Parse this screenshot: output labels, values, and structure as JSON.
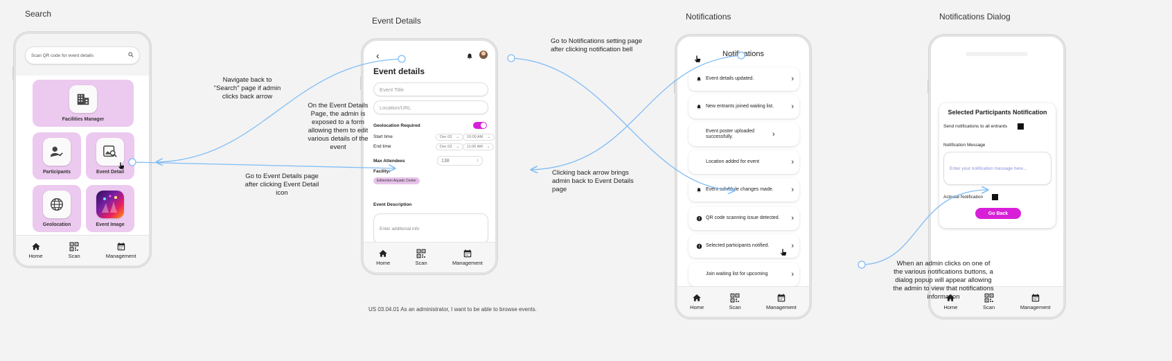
{
  "screens": {
    "search": {
      "label": "Search"
    },
    "event_details": {
      "label": "Event Details"
    },
    "notifications": {
      "label": "Notifications"
    },
    "notifications_dialog": {
      "label": "Notifications Dialog"
    }
  },
  "search_screen": {
    "search_placeholder": "Scan QR code for event details",
    "tiles": {
      "facilities": "Facilities Manager",
      "participants": "Participants",
      "event_detail": "Event Detail",
      "geolocation": "Geolocation",
      "event_image": "Event Image"
    }
  },
  "navbar": {
    "home": "Home",
    "scan": "Scan",
    "management": "Management"
  },
  "event_screen": {
    "heading": "Event details",
    "title_placeholder": "Event Title",
    "location_placeholder": "Location/URL",
    "geolocation_label": "Geolocation Required",
    "start_label": "Start time",
    "end_label": "End time",
    "start_date": "Dec 03",
    "start_time": "10:00 AM",
    "end_date": "Dec 03",
    "end_time": "11:00 AM",
    "max_label": "Max Attendees",
    "max_value": "138",
    "facility_label": "Facility:",
    "facility_chip": "Edmonton Aquatic Center",
    "desc_label": "Event Description",
    "desc_placeholder": "Enter additional info"
  },
  "notif_screen": {
    "title": "Notifications",
    "items": [
      "Event details updated.",
      "New entrants joined waiting list.",
      "Event poster uploaded successfully.",
      "Location added for event",
      "Event schedule changes made.",
      "QR code scanning issue detected.",
      "Selected participants notified.",
      "Join waiting list for upcoming"
    ]
  },
  "dialog_screen": {
    "title": "Selected Participants Notification",
    "send_all": "Send notifications to all entrants",
    "message_label": "Notification Message",
    "message_placeholder": "Enter your notification message here...",
    "activate": "Activate Notification",
    "back_button": "Go Back"
  },
  "annotations": {
    "nav_back": "Navigate back to \"Search\" page if admin clicks back arrow",
    "edit_form": "On the Event Details Page, the admin is exposed to a form allowing them to edit various details of the event",
    "go_details": "Go to Event Details page after clicking Event Detail icon",
    "go_notif": "Go to Notifications setting page after clicking notification bell",
    "back_arrow": "Clicking back arrow brings admin back to Event Details page",
    "dialog_info": "When an admin clicks on one of the various notifications buttons, a dialog popup will appear allowing the admin to view that notifications information",
    "user_story": "US 03.04.01 As an administrator, I want to be able to browse events."
  },
  "colors": {
    "accent": "#d81fd8",
    "tile": "#ecc9ef",
    "arrow": "#7fbcf5",
    "chip": "#e8c2ea"
  }
}
